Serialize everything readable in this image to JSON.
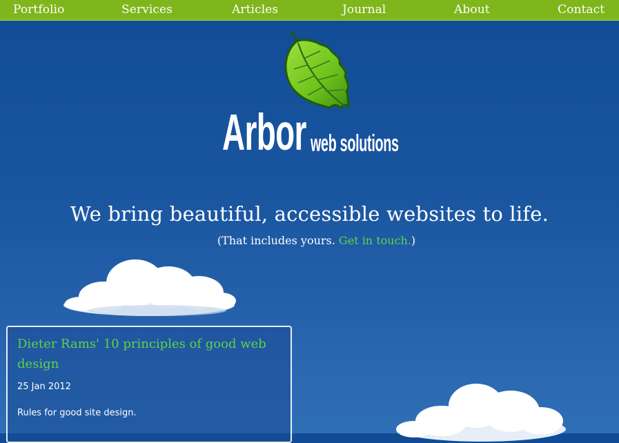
{
  "nav": {
    "items": [
      {
        "label": "Portfolio"
      },
      {
        "label": "Services"
      },
      {
        "label": "Articles"
      },
      {
        "label": "Journal"
      },
      {
        "label": "About"
      },
      {
        "label": "Contact"
      }
    ]
  },
  "brand": {
    "name": "Arbor",
    "tagline": "web solutions",
    "logo_icon": "leaf-icon"
  },
  "hero": {
    "headline": "We bring beautiful, accessible websites to life.",
    "sub_prefix": "(That includes yours.",
    "sub_link": "Get in touch.",
    "sub_suffix": ")"
  },
  "article": {
    "title": "Dieter Rams' 10 principles of good web design",
    "date": "25 Jan 2012",
    "summary": "Rules for good site design."
  },
  "colors": {
    "nav_bg": "#7fb61c",
    "accent_green": "#5ed34a",
    "sky_top": "#114b95",
    "sky_bottom": "#2f6fb6"
  }
}
